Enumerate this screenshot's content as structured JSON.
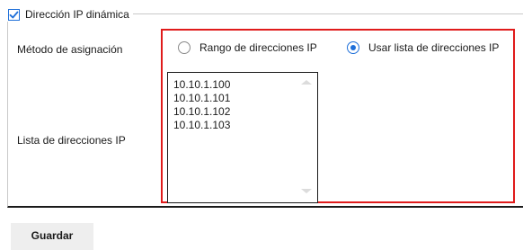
{
  "dynamic_ip": {
    "label": "Dirección IP dinámica",
    "checked": true
  },
  "assignment_method": {
    "label": "Método de asignación",
    "options": [
      {
        "label": "Rango de direcciones IP",
        "selected": false
      },
      {
        "label": "Usar lista de direcciones IP",
        "selected": true
      }
    ]
  },
  "ip_list": {
    "label": "Lista de direcciones IP",
    "items": [
      "10.10.1.100",
      "10.10.1.101",
      "10.10.1.102",
      "10.10.1.103"
    ]
  },
  "save_button": {
    "label": "Guardar"
  },
  "colors": {
    "accent": "#1e6fd9",
    "highlight_border": "#e01b1b",
    "button_bg": "#eeeeee"
  }
}
